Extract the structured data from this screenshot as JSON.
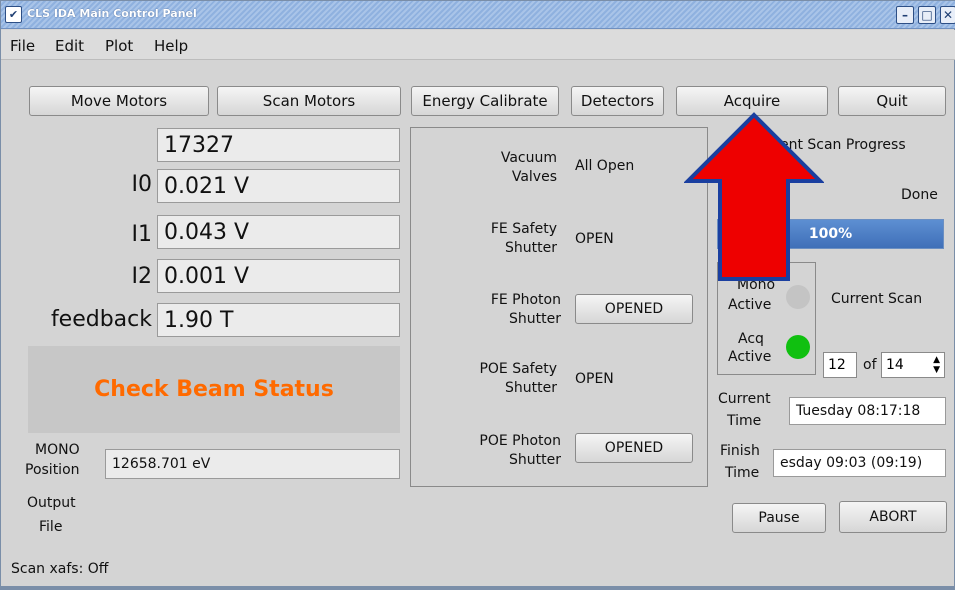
{
  "window": {
    "title": "CLS IDA Main Control Panel"
  },
  "menu": [
    "File",
    "Edit",
    "Plot",
    "Help"
  ],
  "toolbar": {
    "move_motors": "Move Motors",
    "scan_motors": "Scan Motors",
    "energy_calibrate": "Energy Calibrate",
    "detectors": "Detectors",
    "acquire": "Acquire",
    "quit": "Quit"
  },
  "readings": {
    "counter": "17327",
    "i0_label": "I0",
    "i0_value": "0.021 V",
    "i1_label": "I1",
    "i1_value": "0.043 V",
    "i2_label": "I2",
    "i2_value": "0.001 V",
    "feedback_label": "feedback",
    "feedback_value": "1.90 T"
  },
  "beam_status": {
    "text": "Check Beam Status",
    "color": "#ff6a00"
  },
  "mono": {
    "label_line1": "MONO",
    "label_line2": "Position",
    "value": "12658.701 eV"
  },
  "output_file": {
    "label_line1": "Output",
    "label_line2": "File"
  },
  "shutters": {
    "vacuum_label1": "Vacuum",
    "vacuum_label2": "Valves",
    "vacuum_value": "All Open",
    "fe_safety_label1": "FE Safety",
    "fe_safety_label2": "Shutter",
    "fe_safety_value": "OPEN",
    "fe_photon_label1": "FE Photon",
    "fe_photon_label2": "Shutter",
    "fe_photon_button": "OPENED",
    "poe_safety_label1": "POE Safety",
    "poe_safety_label2": "Shutter",
    "poe_safety_value": "OPEN",
    "poe_photon_label1": "POE Photon",
    "poe_photon_label2": "Shutter",
    "poe_photon_button": "OPENED"
  },
  "scan": {
    "progress_title": "rrent Scan Progress",
    "progress_status": "Done",
    "progress_percent": 100,
    "progress_text": "100%",
    "mono_active_1": "Mono",
    "mono_active_2": "Active",
    "acq_active_1": "Acq",
    "acq_active_2": "Active",
    "mono_led_color": "#c4c4c4",
    "acq_led_color": "#10c010",
    "current_scan_label": "Current Scan",
    "current_scan_value": "12",
    "of_label": "of",
    "total_scans": "14",
    "current_time_label1": "Current",
    "current_time_label2": "Time",
    "current_time_value": "Tuesday 08:17:18",
    "finish_time_label1": "Finish",
    "finish_time_label2": "Time",
    "finish_time_value": "esday 09:03  (09:19)",
    "pause": "Pause",
    "abort": "ABORT"
  },
  "status_bar": {
    "text": "Scan xafs: Off"
  },
  "annotation": {
    "arrow_color": "#ee0000",
    "arrow_outline": "#1a3fa0",
    "arrow_icon": "up-arrow-icon"
  }
}
